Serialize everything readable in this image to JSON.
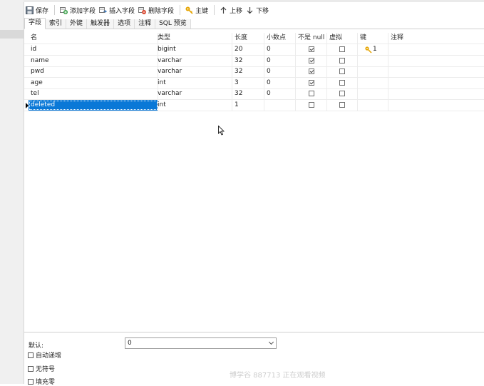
{
  "toolbar": {
    "save": "保存",
    "add_field": "添加字段",
    "insert_field": "插入字段",
    "delete_field": "删除字段",
    "primary_key": "主键",
    "move_up": "上移",
    "move_down": "下移"
  },
  "tabs": [
    {
      "label": "字段",
      "active": true
    },
    {
      "label": "索引",
      "active": false
    },
    {
      "label": "外键",
      "active": false
    },
    {
      "label": "触发器",
      "active": false
    },
    {
      "label": "选项",
      "active": false
    },
    {
      "label": "注释",
      "active": false
    },
    {
      "label": "SQL 预览",
      "active": false
    }
  ],
  "grid": {
    "headers": [
      "名",
      "类型",
      "长度",
      "小数点",
      "不是 null",
      "虚拟",
      "键",
      "注释"
    ],
    "rows": [
      {
        "name": "id",
        "type": "bigint",
        "length": "20",
        "decimal": "0",
        "not_null": true,
        "virtual": false,
        "key": "1",
        "comment": ""
      },
      {
        "name": "name",
        "type": "varchar",
        "length": "32",
        "decimal": "0",
        "not_null": true,
        "virtual": false,
        "key": "",
        "comment": ""
      },
      {
        "name": "pwd",
        "type": "varchar",
        "length": "32",
        "decimal": "0",
        "not_null": true,
        "virtual": false,
        "key": "",
        "comment": ""
      },
      {
        "name": "age",
        "type": "int",
        "length": "3",
        "decimal": "0",
        "not_null": true,
        "virtual": false,
        "key": "",
        "comment": ""
      },
      {
        "name": "tel",
        "type": "varchar",
        "length": "32",
        "decimal": "0",
        "not_null": false,
        "virtual": false,
        "key": "",
        "comment": ""
      },
      {
        "name": "deleted",
        "type": "int",
        "length": "1",
        "decimal": "",
        "not_null": false,
        "virtual": false,
        "key": "",
        "comment": ""
      }
    ],
    "selected_row": 5
  },
  "properties": {
    "default_label": "默认:",
    "default_value": "0",
    "auto_increment": "自动递增",
    "unsigned": "无符号",
    "zerofill": "填充零"
  },
  "watermark": "博学谷 887713 正在观看视频",
  "colors": {
    "selection": "#0a78d7",
    "key_icon": "#e6a400"
  }
}
